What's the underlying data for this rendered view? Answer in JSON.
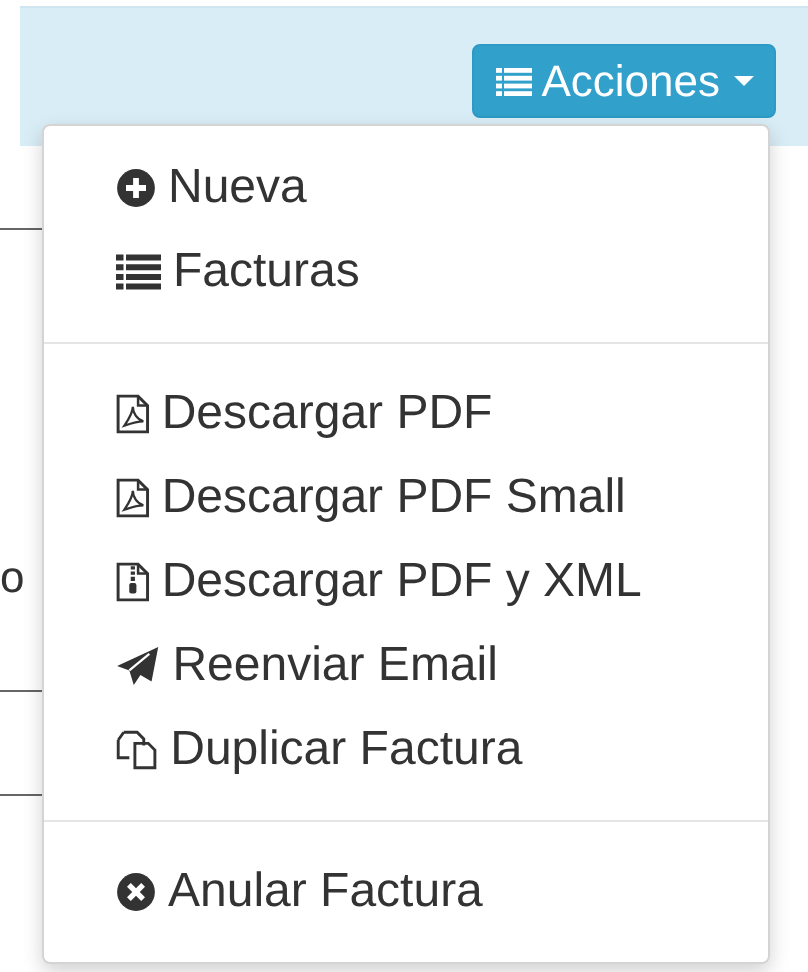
{
  "background_text": "o",
  "actions_button": {
    "kind": "list",
    "label": "Acciones",
    "expanded": true
  },
  "menu": {
    "groups": [
      {
        "items": [
          {
            "kind": "plus-circle",
            "label": "Nueva"
          },
          {
            "kind": "list",
            "label": "Facturas"
          }
        ]
      },
      {
        "items": [
          {
            "kind": "file-pdf",
            "label": "Descargar PDF"
          },
          {
            "kind": "file-pdf",
            "label": "Descargar PDF Small"
          },
          {
            "kind": "file-zip",
            "label": "Descargar PDF y XML"
          },
          {
            "kind": "send",
            "label": "Reenviar Email"
          },
          {
            "kind": "copy",
            "label": "Duplicar Factura"
          }
        ]
      },
      {
        "items": [
          {
            "kind": "times-circle",
            "label": "Anular Factura"
          }
        ]
      }
    ]
  }
}
